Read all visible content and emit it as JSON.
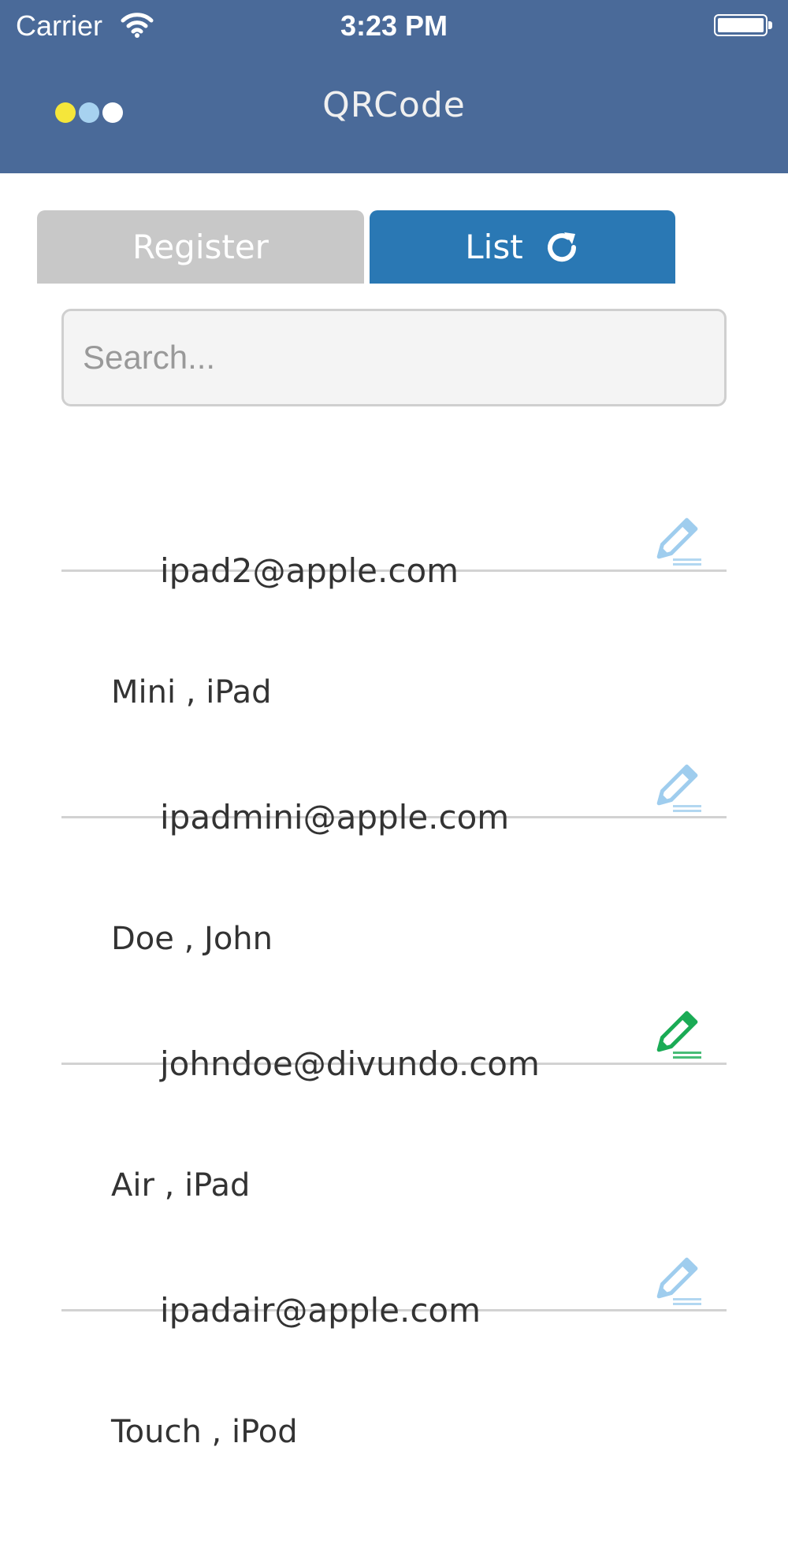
{
  "status_bar": {
    "carrier": "Carrier",
    "time": "3:23 PM"
  },
  "nav": {
    "title": "QRCode",
    "dot_colors": [
      "#f5e63a",
      "#a7d2f0",
      "#ffffff"
    ]
  },
  "tabs": {
    "register_label": "Register",
    "list_label": "List"
  },
  "search": {
    "placeholder": "Search..."
  },
  "entries": [
    {
      "name": "",
      "email": "ipad2@apple.com",
      "edit_color": "#9fcdee"
    },
    {
      "name": "Mini , iPad",
      "email": "ipadmini@apple.com",
      "edit_color": "#9fcdee"
    },
    {
      "name": "Doe , John",
      "email": "johndoe@divundo.com",
      "edit_color": "#1aab55"
    },
    {
      "name": "Air , iPad",
      "email": "ipadair@apple.com",
      "edit_color": "#9fcdee"
    },
    {
      "name": "Touch , iPod",
      "email": "",
      "edit_color": ""
    }
  ]
}
